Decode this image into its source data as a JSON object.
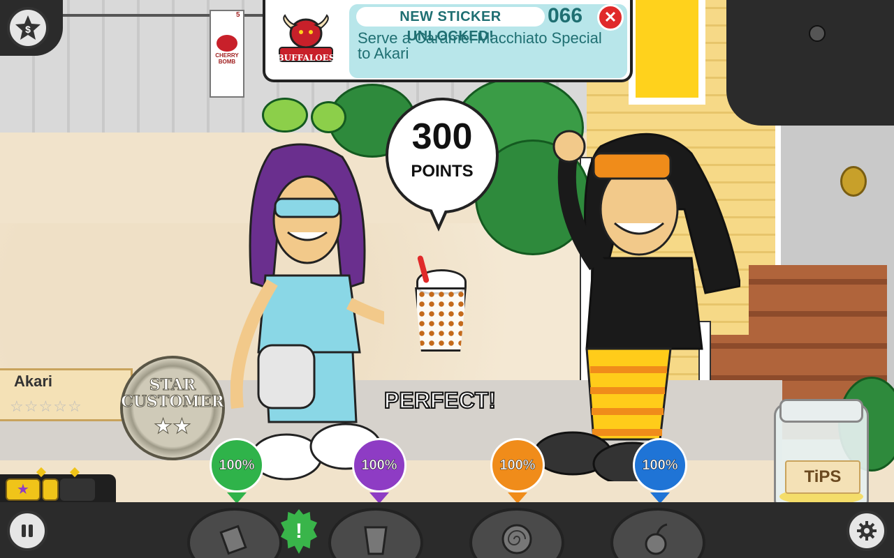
{
  "hud": {
    "star_button_icon": "star-badge-icon",
    "pause_icon": "pause-icon",
    "settings_icon": "gear-icon"
  },
  "sticker_banner": {
    "title": "NEW STICKER UNLOCKED!",
    "number": "066",
    "description": "Serve a Caramel Macchiato Special to Akari",
    "logo_text": "BUFFALOES",
    "close_icon": "close-icon"
  },
  "poster": {
    "number": "5",
    "label": "CHERRY BOMB"
  },
  "speech_bubble": {
    "points_value": "300",
    "points_label": "POINTS"
  },
  "result_label": "PERFECT!",
  "customer": {
    "name": "Akari",
    "stars_filled": 0,
    "stars_total": 5,
    "badge_title": "STAR CUSTOMER",
    "badge_stars": 2
  },
  "scores": [
    {
      "value": "100%",
      "color": "#2fb34a"
    },
    {
      "value": "100%",
      "color": "#8e3cc4"
    },
    {
      "value": "100%",
      "color": "#f08c1a"
    },
    {
      "value": "100%",
      "color": "#1f74d6"
    }
  ],
  "tips_jar": {
    "label": "TiPS"
  },
  "toolbar": {
    "stations": [
      {
        "name": "order-station",
        "icon": "ticket-icon"
      },
      {
        "name": "build-station",
        "icon": "cup-icon"
      },
      {
        "name": "brew-station",
        "icon": "swirl-icon"
      },
      {
        "name": "topping-station",
        "icon": "cherry-icon"
      }
    ],
    "alert_symbol": "!"
  },
  "colors": {
    "banner_text": "#1f6f72",
    "banner_bg": "#b8e6ea",
    "close_red": "#e02a2a"
  }
}
